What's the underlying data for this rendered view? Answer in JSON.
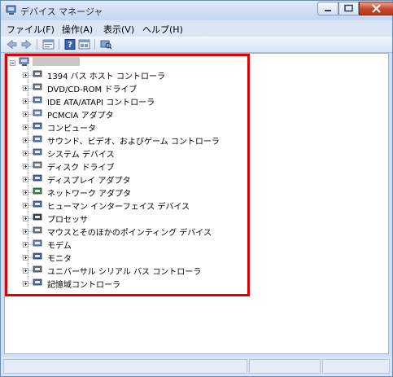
{
  "window": {
    "title": "デバイス マネージャ",
    "close_color": "#c5452a"
  },
  "menu": {
    "items": [
      {
        "label": "ファイル(F)"
      },
      {
        "label": "操作(A)"
      },
      {
        "label": "表示(V)"
      },
      {
        "label": "ヘルプ(H)"
      }
    ]
  },
  "toolbar": {
    "buttons": [
      "back-arrow-icon",
      "forward-arrow-icon",
      "properties-icon",
      "help-icon",
      "view-icon",
      "scan-hardware-icon"
    ]
  },
  "tree": {
    "root_icon": "computer-icon",
    "root_label_redacted": true,
    "highlight_color": "#e00000",
    "items": [
      {
        "label": "1394 バス ホスト コントローラ",
        "icon": "1394-controller-icon"
      },
      {
        "label": "DVD/CD-ROM ドライブ",
        "icon": "dvd-drive-icon"
      },
      {
        "label": "IDE ATA/ATAPI コントローラ",
        "icon": "ide-controller-icon"
      },
      {
        "label": "PCMCIA アダプタ",
        "icon": "pcmcia-adapter-icon"
      },
      {
        "label": "コンピュータ",
        "icon": "computer-icon"
      },
      {
        "label": "サウンド、ビデオ、およびゲーム コントローラ",
        "icon": "sound-icon"
      },
      {
        "label": "システム デバイス",
        "icon": "system-device-icon"
      },
      {
        "label": "ディスク ドライブ",
        "icon": "disk-drive-icon"
      },
      {
        "label": "ディスプレイ アダプタ",
        "icon": "display-adapter-icon"
      },
      {
        "label": "ネットワーク アダプタ",
        "icon": "network-adapter-icon"
      },
      {
        "label": "ヒューマン インターフェイス デバイス",
        "icon": "hid-icon"
      },
      {
        "label": "プロセッサ",
        "icon": "processor-icon"
      },
      {
        "label": "マウスとそのほかのポインティング デバイス",
        "icon": "mouse-icon"
      },
      {
        "label": "モデム",
        "icon": "modem-icon"
      },
      {
        "label": "モニタ",
        "icon": "monitor-icon"
      },
      {
        "label": "ユニバーサル シリアル バス コントローラ",
        "icon": "usb-controller-icon"
      },
      {
        "label": "記憶域コントローラ",
        "icon": "storage-controller-icon"
      }
    ]
  }
}
